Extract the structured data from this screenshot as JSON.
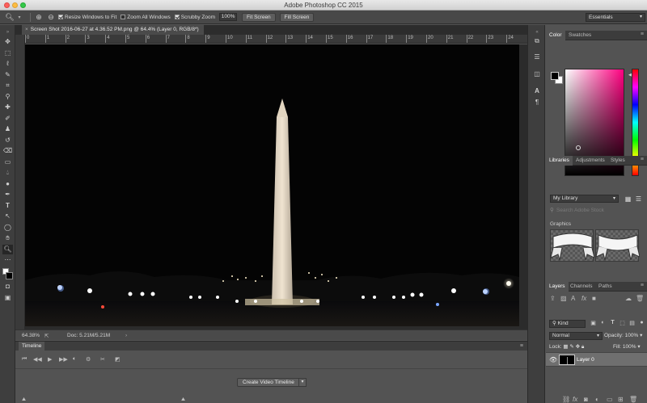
{
  "app": {
    "title": "Adobe Photoshop CC 2015"
  },
  "options": {
    "resize_windows": "Resize Windows to Fit",
    "zoom_all": "Zoom All Windows",
    "scrubby": "Scrubby Zoom",
    "zoom_value": "100%",
    "fit_screen": "Fit Screen",
    "fill_screen": "Fill Screen",
    "workspace": "Essentials"
  },
  "document": {
    "tab_title": "Screen Shot 2016-06-27 at 4.36.52 PM.png @ 64.4% (Layer 0, RGB/8*)",
    "zoom": "64.38%",
    "doc_size": "Doc: 5.21M/5.21M",
    "ruler_numbers": [
      "0",
      "1",
      "2",
      "3",
      "4",
      "5",
      "6",
      "7",
      "8",
      "9",
      "10",
      "11",
      "12",
      "13",
      "14",
      "15",
      "16",
      "17",
      "18",
      "19",
      "20",
      "21",
      "22",
      "23",
      "24"
    ]
  },
  "timeline": {
    "tab": "Timeline",
    "create_button": "Create Video Timeline"
  },
  "color_panel": {
    "tabs": [
      "Color",
      "Swatches"
    ],
    "foreground": "#000000",
    "background": "#ffffff",
    "hue_color": "#ff0080"
  },
  "libraries_panel": {
    "tabs": [
      "Libraries",
      "Adjustments",
      "Styles"
    ],
    "library": "My Library",
    "search_placeholder": "Search Adobe Stock",
    "section": "Graphics"
  },
  "layers_panel": {
    "tabs": [
      "Layers",
      "Channels",
      "Paths"
    ],
    "kind": "Kind",
    "blend_mode": "Normal",
    "opacity_label": "Opacity:",
    "opacity_value": "100%",
    "lock_label": "Lock:",
    "fill_label": "Fill:",
    "fill_value": "100%",
    "layers": [
      {
        "name": "Layer 0"
      }
    ]
  }
}
